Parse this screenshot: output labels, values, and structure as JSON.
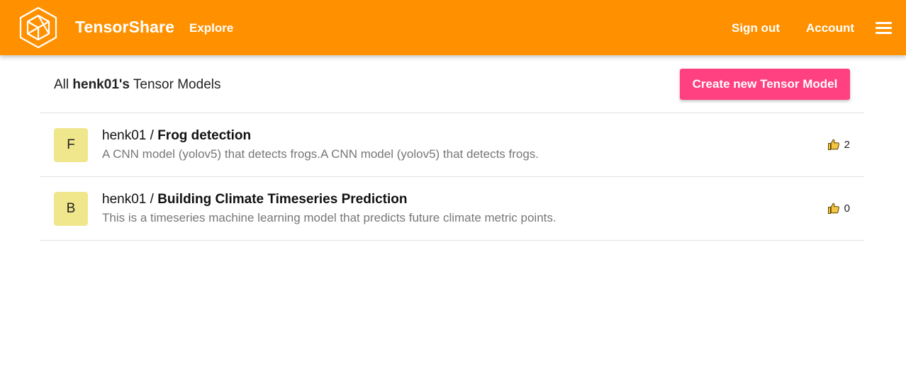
{
  "header": {
    "brand": "TensorShare",
    "nav": {
      "explore": "Explore",
      "sign_out": "Sign out",
      "account": "Account"
    },
    "icons": {
      "logo": "cube-logo-icon",
      "menu": "hamburger-menu-icon"
    },
    "colors": {
      "bar": "#ff9100"
    }
  },
  "page": {
    "heading_prefix": "All",
    "heading_user": "henk01's",
    "heading_suffix": "Tensor Models",
    "create_button": "Create new Tensor Model",
    "create_button_color": "#ff4081"
  },
  "models": [
    {
      "initial": "F",
      "owner": "henk01",
      "separator": "/",
      "name": "Frog detection",
      "description": "A CNN model (yolov5) that detects frogs.A CNN model (yolov5) that detects frogs.",
      "likes": "2",
      "avatar_color": "#f0e68c",
      "like_icon": "thumbs-up-icon"
    },
    {
      "initial": "B",
      "owner": "henk01",
      "separator": "/",
      "name": "Building Climate Timeseries Prediction",
      "description": "This is a timeseries machine learning model that predicts future climate metric points.",
      "likes": "0",
      "avatar_color": "#f0e68c",
      "like_icon": "thumbs-up-icon"
    }
  ]
}
